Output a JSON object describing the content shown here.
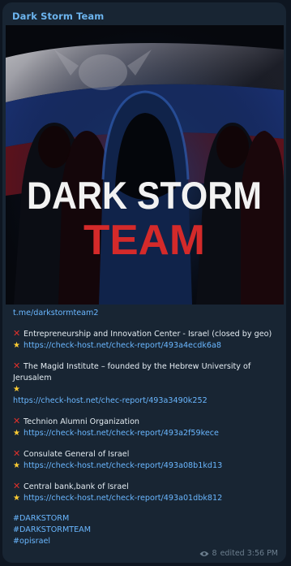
{
  "channel": {
    "name": "Dark Storm Team"
  },
  "media": {
    "title_line1": "DARK STORM",
    "title_line2": "TEAM"
  },
  "message": {
    "channel_link": "t.me/darkstormteam2",
    "entries": [
      {
        "name": "Entrepreneurship and Innovation Center - Israel (closed by geo)",
        "url": "https://check-host.net/check-report/493a4ecdk6a8"
      },
      {
        "name_line1": "The Magid Institute – founded by the Hebrew University of",
        "name_line2": "Jerusalem",
        "url": "https://check-host.net/chec-report/493a3490k252"
      },
      {
        "name": "Technion Alumni Organization",
        "url": "https://check-host.net/check-report/493a2f59kece"
      },
      {
        "name": "Consulate General of Israel",
        "url": "https://check-host.net/check-report/493a08b1kd13"
      },
      {
        "name": "Central bank,bank of Israel",
        "url": "https://check-host.net/check-report/493a01dbk812"
      }
    ],
    "hashtags": [
      "#DARKSTORM",
      "#DARKSTORMTEAM",
      "#opisrael"
    ]
  },
  "footer": {
    "views": "8",
    "edited": "edited 3:56 PM"
  },
  "icons": {
    "cross": "red-x-icon",
    "star": "star-icon",
    "views": "eye-icon"
  },
  "colors": {
    "bubble": "#182533",
    "link": "#6ab7ff",
    "title_red": "#d42a2a"
  }
}
